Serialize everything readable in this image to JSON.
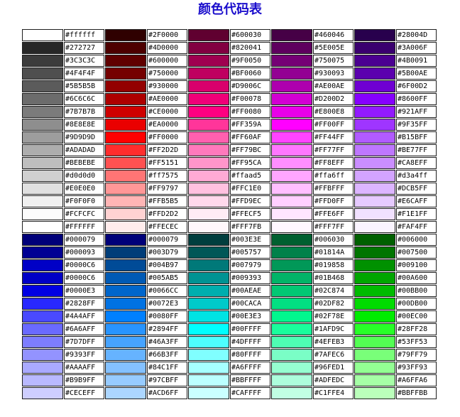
{
  "title": "颜色代码表",
  "rows": [
    [
      "#ffffff",
      "#2F0000",
      "#600030",
      "#460046",
      "#28004D"
    ],
    [
      "#272727",
      "#4D0000",
      "#820041",
      "#5E005E",
      "#3A006F"
    ],
    [
      "#3C3C3C",
      "#600000",
      "#9F0050",
      "#750075",
      "#4B0091"
    ],
    [
      "#4F4F4F",
      "#750000",
      "#BF0060",
      "#930093",
      "#5B00AE"
    ],
    [
      "#5B5B5B",
      "#930000",
      "#D9006C",
      "#AE00AE",
      "#6F00D2"
    ],
    [
      "#6C6C6C",
      "#AE0000",
      "#F00078",
      "#D200D2",
      "#8600FF"
    ],
    [
      "#7B7B7B",
      "#CE0000",
      "#FF0080",
      "#E800E8",
      "#921AFF"
    ],
    [
      "#8E8E8E",
      "#EA0000",
      "#FF359A",
      "#FF00FF",
      "#9F35FF"
    ],
    [
      "#9D9D9D",
      "#FF0000",
      "#FF60AF",
      "#FF44FF",
      "#B15BFF"
    ],
    [
      "#ADADAD",
      "#FF2D2D",
      "#FF79BC",
      "#FF77FF",
      "#BE77FF"
    ],
    [
      "#BEBEBE",
      "#FF5151",
      "#FF95CA",
      "#FF8EFF",
      "#CA8EFF"
    ],
    [
      "#d0d0d0",
      "#ff7575",
      "#ffaad5",
      "#ffa6ff",
      "#d3a4ff"
    ],
    [
      "#E0E0E0",
      "#FF9797",
      "#FFC1E0",
      "#FFBFFF",
      "#DCB5FF"
    ],
    [
      "#F0F0F0",
      "#FFB5B5",
      "#FFD9EC",
      "#FFD0FF",
      "#E6CAFF"
    ],
    [
      "#FCFCFC",
      "#FFD2D2",
      "#FFECF5",
      "#FFE6FF",
      "#F1E1FF"
    ],
    [
      "#FFFFFF",
      "#FFECEC",
      "#FFF7FB",
      "#FFF7FF",
      "#FAF4FF"
    ],
    [
      "#000079",
      "#000079",
      "#003E3E",
      "#006030",
      "#006000"
    ],
    [
      "#000093",
      "#003D79",
      "#005757",
      "#01814A",
      "#007500"
    ],
    [
      "#0000C6",
      "#004B97",
      "#007979",
      "#019858",
      "#009100"
    ],
    [
      "#0000C6",
      "#005AB5",
      "#009393",
      "#01B468",
      "#00A600"
    ],
    [
      "#0000E3",
      "#0066CC",
      "#00AEAE",
      "#02C874",
      "#00BB00"
    ],
    [
      "#2828FF",
      "#0072E3",
      "#00CACA",
      "#02DF82",
      "#00DB00"
    ],
    [
      "#4A4AFF",
      "#0080FF",
      "#00E3E3",
      "#02F78E",
      "#00EC00"
    ],
    [
      "#6A6AFF",
      "#2894FF",
      "#00FFFF",
      "#1AFD9C",
      "#28FF28"
    ],
    [
      "#7D7DFF",
      "#46A3FF",
      "#4DFFFF",
      "#4EFEB3",
      "#53FF53"
    ],
    [
      "#9393FF",
      "#66B3FF",
      "#80FFFF",
      "#7AFEC6",
      "#79FF79"
    ],
    [
      "#AAAAFF",
      "#84C1FF",
      "#A6FFFF",
      "#96FED1",
      "#93FF93"
    ],
    [
      "#B9B9FF",
      "#97CBFF",
      "#BBFFFF",
      "#ADFEDC",
      "#A6FFA6"
    ],
    [
      "#CECEFF",
      "#ACD6FF",
      "#CAFFFF",
      "#C1FFE4",
      "#BBFFBB"
    ]
  ]
}
